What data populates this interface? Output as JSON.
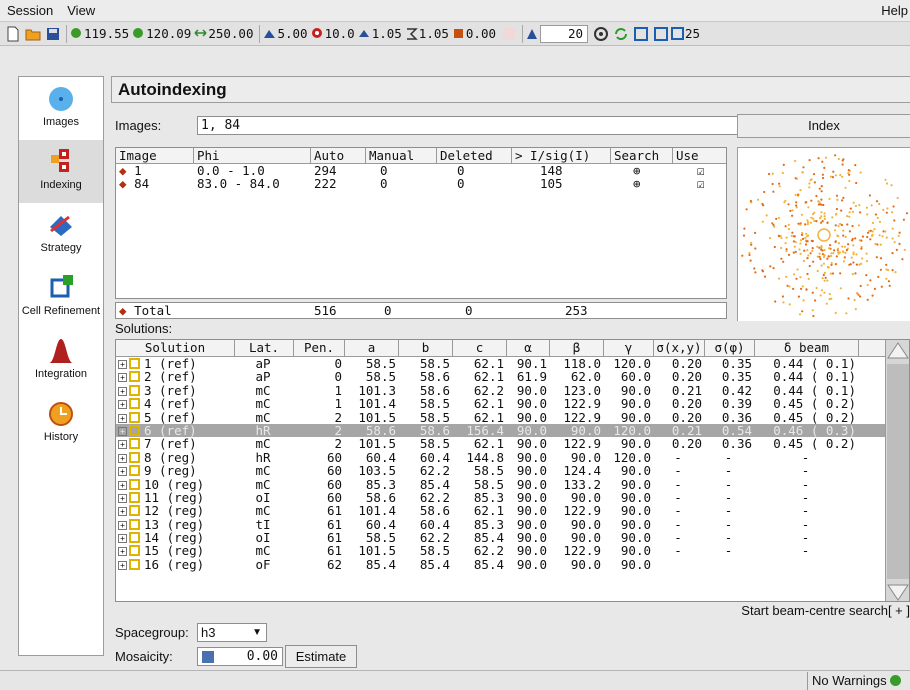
{
  "menu": {
    "session": "Session",
    "view": "View",
    "help": "Help"
  },
  "toolbar": {
    "fields": [
      "119.55",
      "120.09",
      "250.00",
      "5.00",
      "10.0",
      "1.05",
      "1.05",
      "0.00",
      "20",
      "25"
    ]
  },
  "nav": {
    "items": [
      {
        "label": "Images",
        "icon": "images-icon"
      },
      {
        "label": "Indexing",
        "icon": "indexing-icon"
      },
      {
        "label": "Strategy",
        "icon": "strategy-icon"
      },
      {
        "label": "Cell Refinement",
        "icon": "cell-refinement-icon"
      },
      {
        "label": "Integration",
        "icon": "integration-icon"
      },
      {
        "label": "History",
        "icon": "history-icon"
      }
    ]
  },
  "main": {
    "title": "Autoindexing",
    "images_label": "Images:",
    "images_value": "1, 84",
    "index_button": "Index",
    "images_table": {
      "headers": [
        "Image",
        "Phi",
        "Auto",
        "Manual",
        "Deleted",
        "> I/sig(I)",
        "Search",
        "Use"
      ],
      "rows": [
        {
          "image": "1",
          "phi": "0.0 - 1.0",
          "auto": "294",
          "manual": "0",
          "deleted": "0",
          "isig": "148"
        },
        {
          "image": "84",
          "phi": "83.0 - 84.0",
          "auto": "222",
          "manual": "0",
          "deleted": "0",
          "isig": "105"
        }
      ],
      "total": {
        "label": "Total",
        "auto": "516",
        "manual": "0",
        "deleted": "0",
        "isig": "253"
      }
    },
    "solutions_label": "Solutions:",
    "solutions_table": {
      "headers": [
        "Solution",
        "Lat.",
        "Pen.",
        "a",
        "b",
        "c",
        "α",
        "β",
        "γ",
        "σ(x,y)",
        "σ(φ)",
        "δ beam"
      ],
      "rows": [
        [
          "1 (ref)",
          "aP",
          "0",
          "58.5",
          "58.5",
          "62.1",
          "90.1",
          "118.0",
          "120.0",
          "0.20",
          "0.35",
          "0.44 ( 0.1)"
        ],
        [
          "2 (ref)",
          "aP",
          "0",
          "58.5",
          "58.6",
          "62.1",
          "61.9",
          "62.0",
          "60.0",
          "0.20",
          "0.35",
          "0.44 ( 0.1)"
        ],
        [
          "3 (ref)",
          "mC",
          "1",
          "101.3",
          "58.6",
          "62.2",
          "90.0",
          "123.0",
          "90.0",
          "0.21",
          "0.42",
          "0.44 ( 0.1)"
        ],
        [
          "4 (ref)",
          "mC",
          "1",
          "101.4",
          "58.5",
          "62.1",
          "90.0",
          "122.9",
          "90.0",
          "0.20",
          "0.39",
          "0.45 ( 0.2)"
        ],
        [
          "5 (ref)",
          "mC",
          "2",
          "101.5",
          "58.5",
          "62.1",
          "90.0",
          "122.9",
          "90.0",
          "0.20",
          "0.36",
          "0.45 ( 0.2)"
        ],
        [
          "6 (ref)",
          "hR",
          "2",
          "58.6",
          "58.6",
          "156.4",
          "90.0",
          "90.0",
          "120.0",
          "0.21",
          "0.54",
          "0.46 ( 0.3)"
        ],
        [
          "7 (ref)",
          "mC",
          "2",
          "101.5",
          "58.5",
          "62.1",
          "90.0",
          "122.9",
          "90.0",
          "0.20",
          "0.36",
          "0.45 ( 0.2)"
        ],
        [
          "8 (reg)",
          "hR",
          "60",
          "60.4",
          "60.4",
          "144.8",
          "90.0",
          "90.0",
          "120.0",
          "-",
          "-",
          "-"
        ],
        [
          "9 (reg)",
          "mC",
          "60",
          "103.5",
          "62.2",
          "58.5",
          "90.0",
          "124.4",
          "90.0",
          "-",
          "-",
          "-"
        ],
        [
          "10 (reg)",
          "mC",
          "60",
          "85.3",
          "85.4",
          "58.5",
          "90.0",
          "133.2",
          "90.0",
          "-",
          "-",
          "-"
        ],
        [
          "11 (reg)",
          "oI",
          "60",
          "58.6",
          "62.2",
          "85.3",
          "90.0",
          "90.0",
          "90.0",
          "-",
          "-",
          "-"
        ],
        [
          "12 (reg)",
          "mC",
          "61",
          "101.4",
          "58.6",
          "62.1",
          "90.0",
          "122.9",
          "90.0",
          "-",
          "-",
          "-"
        ],
        [
          "13 (reg)",
          "tI",
          "61",
          "60.4",
          "60.4",
          "85.3",
          "90.0",
          "90.0",
          "90.0",
          "-",
          "-",
          "-"
        ],
        [
          "14 (reg)",
          "oI",
          "61",
          "58.5",
          "62.2",
          "85.4",
          "90.0",
          "90.0",
          "90.0",
          "-",
          "-",
          "-"
        ],
        [
          "15 (reg)",
          "mC",
          "61",
          "101.5",
          "58.5",
          "62.2",
          "90.0",
          "122.9",
          "90.0",
          "-",
          "-",
          "-"
        ],
        [
          "16 (reg)",
          "oF",
          "62",
          "85.4",
          "85.4",
          "85.4",
          "90.0",
          "90.0",
          "90.0",
          "",
          "",
          ""
        ]
      ],
      "highlighted_row": 5
    },
    "beam_search": "Start beam-centre search[ + ]",
    "spacegroup_label": "Spacegroup:",
    "spacegroup_value": "h3",
    "mosaicity_label": "Mosaicity:",
    "mosaicity_value": "0.00",
    "estimate_button": "Estimate"
  },
  "status": {
    "text": "No Warnings"
  }
}
